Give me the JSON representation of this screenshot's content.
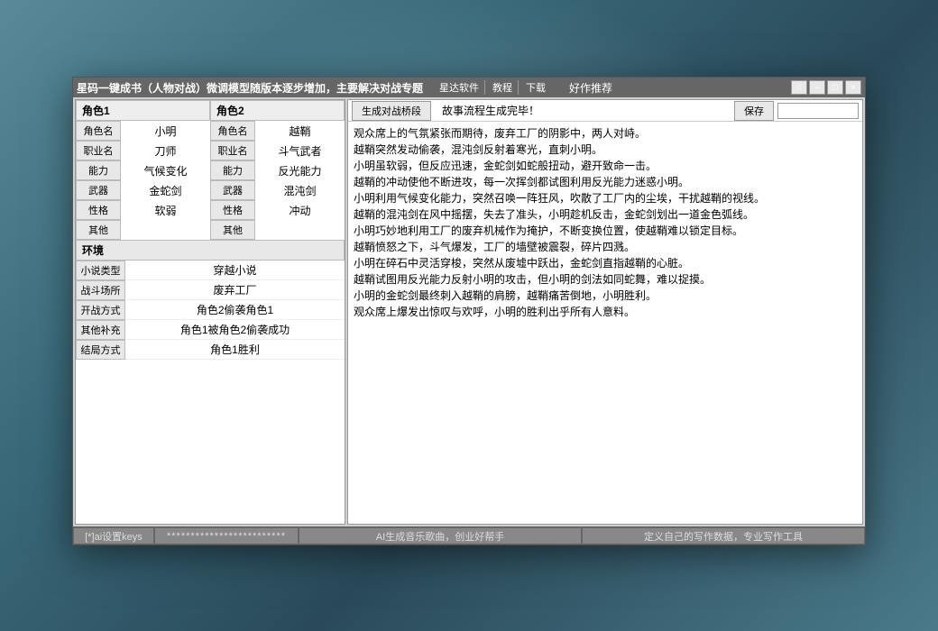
{
  "window": {
    "title": "星码一键成书（人物对战）微调模型随版本逐步增加，主要解决对战专题",
    "links": [
      "星达软件",
      "教程",
      "下载"
    ],
    "rec": "好作推荐",
    "star": "☆",
    "min": "–",
    "max": "□",
    "close": "×"
  },
  "char1": {
    "header": "角色1",
    "rows": [
      {
        "label": "角色名",
        "value": "小明"
      },
      {
        "label": "职业名",
        "value": "刀师"
      },
      {
        "label": "能力",
        "value": "气候变化"
      },
      {
        "label": "武器",
        "value": "金蛇剑"
      },
      {
        "label": "性格",
        "value": "软弱"
      },
      {
        "label": "其他",
        "value": ""
      }
    ]
  },
  "char2": {
    "header": "角色2",
    "rows": [
      {
        "label": "角色名",
        "value": "越鞘"
      },
      {
        "label": "职业名",
        "value": "斗气武者"
      },
      {
        "label": "能力",
        "value": "反光能力"
      },
      {
        "label": "武器",
        "value": "混沌剑"
      },
      {
        "label": "性格",
        "value": "冲动"
      },
      {
        "label": "其他",
        "value": ""
      }
    ]
  },
  "env": {
    "header": "环境",
    "rows": [
      {
        "label": "小说类型",
        "value": "穿越小说"
      },
      {
        "label": "战斗场所",
        "value": "废弃工厂"
      },
      {
        "label": "开战方式",
        "value": "角色2偷袭角色1"
      },
      {
        "label": "其他补充",
        "value": "角色1被角色2偷袭成功"
      },
      {
        "label": "结局方式",
        "value": "角色1胜利"
      }
    ]
  },
  "toolbar": {
    "generate": "生成对战桥段",
    "status": "故事流程生成完毕！",
    "save": "保存"
  },
  "story": "观众席上的气氛紧张而期待，废弃工厂的阴影中，两人对峙。\n越鞘突然发动偷袭，混沌剑反射着寒光，直刺小明。\n小明虽软弱，但反应迅速，金蛇剑如蛇般扭动，避开致命一击。\n越鞘的冲动使他不断进攻，每一次挥剑都试图利用反光能力迷惑小明。\n小明利用气候变化能力，突然召唤一阵狂风，吹散了工厂内的尘埃，干扰越鞘的视线。\n越鞘的混沌剑在风中摇摆，失去了准头，小明趁机反击，金蛇剑划出一道金色弧线。\n小明巧妙地利用工厂的废弃机械作为掩护，不断变换位置，使越鞘难以锁定目标。\n越鞘愤怒之下，斗气爆发，工厂的墙壁被震裂，碎片四溅。\n小明在碎石中灵活穿梭，突然从废墟中跃出，金蛇剑直指越鞘的心脏。\n越鞘试图用反光能力反射小明的攻击，但小明的剑法如同蛇舞，难以捉摸。\n小明的金蛇剑最终刺入越鞘的肩膀，越鞘痛苦倒地，小明胜利。\n观众席上爆发出惊叹与欢呼，小明的胜利出乎所有人意料。",
  "footer": {
    "keys": "[*]ai设置keys",
    "password": "*************************",
    "music": "AI生成音乐歌曲，创业好帮手",
    "define": "定义自己的写作数据，专业写作工具"
  }
}
